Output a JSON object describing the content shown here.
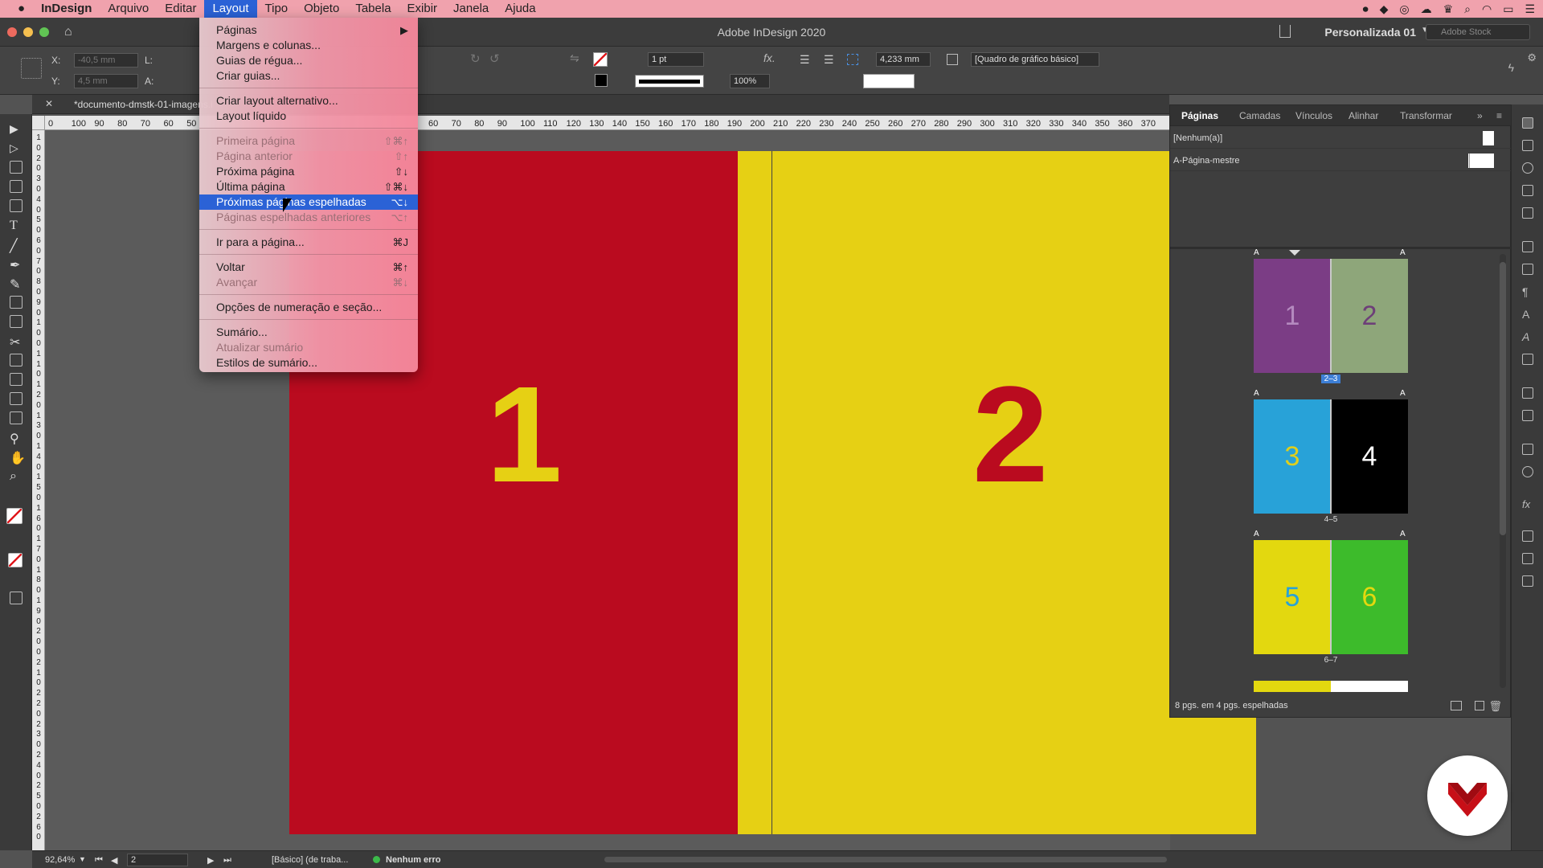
{
  "menubar": {
    "apple": "",
    "app": "InDesign",
    "items": [
      "Arquivo",
      "Editar",
      "Layout",
      "Tipo",
      "Objeto",
      "Tabela",
      "Exibir",
      "Janela",
      "Ajuda"
    ]
  },
  "titlebar": {
    "title": "Adobe InDesign 2020",
    "workspace": "Personalizada 01",
    "search_placeholder": "Adobe Stock"
  },
  "control": {
    "x_label": "X:",
    "x_value": "-40,5 mm",
    "y_label": "Y:",
    "y_value": "4,5 mm",
    "l_label": "L:",
    "a_label": "A:",
    "stroke_weight": "1 pt",
    "scale": "100%",
    "size_value": "4,233 mm",
    "object_style": "[Quadro de gráfico básico]"
  },
  "document": {
    "tab": "*documento-dmstk-01-imagens.i",
    "page1_number": "1",
    "page2_number": "2"
  },
  "ruler": {
    "left_ticks": [
      "0",
      "100",
      "90",
      "80",
      "70",
      "60",
      "50"
    ],
    "right_ticks": [
      "60",
      "70",
      "80",
      "90",
      "100",
      "110",
      "120",
      "130",
      "140",
      "150",
      "160",
      "170",
      "180",
      "190",
      "200",
      "210",
      "220",
      "230",
      "240",
      "250",
      "260",
      "270",
      "280",
      "290",
      "300",
      "310",
      "320",
      "330",
      "340",
      "350",
      "360",
      "370"
    ]
  },
  "menu": {
    "items": [
      {
        "label": "Páginas",
        "shortcut": "▶",
        "disabled": false
      },
      {
        "label": "Margens e colunas...",
        "shortcut": "",
        "disabled": false
      },
      {
        "label": "Guias de régua...",
        "shortcut": "",
        "disabled": false
      },
      {
        "label": "Criar guias...",
        "shortcut": "",
        "disabled": false
      },
      {
        "label": "Criar layout alternativo...",
        "shortcut": "",
        "disabled": false
      },
      {
        "label": "Layout líquido",
        "shortcut": "",
        "disabled": false
      },
      {
        "label": "Primeira página",
        "shortcut": "⇧⌘↑",
        "disabled": true
      },
      {
        "label": "Página anterior",
        "shortcut": "⇧↑",
        "disabled": true
      },
      {
        "label": "Próxima página",
        "shortcut": "⇧↓",
        "disabled": false
      },
      {
        "label": "Última página",
        "shortcut": "⇧⌘↓",
        "disabled": false
      },
      {
        "label": "Próximas páginas espelhadas",
        "shortcut": "⌥↓",
        "disabled": false,
        "highlighted": true
      },
      {
        "label": "Páginas espelhadas anteriores",
        "shortcut": "⌥↑",
        "disabled": true
      },
      {
        "label": "Ir para a página...",
        "shortcut": "⌘J",
        "disabled": false
      },
      {
        "label": "Voltar",
        "shortcut": "⌘↑",
        "disabled": false
      },
      {
        "label": "Avançar",
        "shortcut": "⌘↓",
        "disabled": true
      },
      {
        "label": "Opções de numeração e seção...",
        "shortcut": "",
        "disabled": false
      },
      {
        "label": "Sumário...",
        "shortcut": "",
        "disabled": false
      },
      {
        "label": "Atualizar sumário",
        "shortcut": "",
        "disabled": true
      },
      {
        "label": "Estilos de sumário...",
        "shortcut": "",
        "disabled": false
      }
    ]
  },
  "panel": {
    "tabs": [
      "Páginas",
      "Camadas",
      "Vínculos",
      "Alinhar",
      "Transformar"
    ],
    "masters": [
      "[Nenhum(a)]",
      "A-Página-mestre"
    ],
    "master_prefix": "A",
    "spreads": [
      {
        "label": "2–3",
        "pages": [
          {
            "n": "1",
            "bg": "#7b3d85",
            "fg": "#b48abf"
          },
          {
            "n": "2",
            "bg": "#8ea67a",
            "fg": "#6d3f78"
          }
        ]
      },
      {
        "label": "4–5",
        "pages": [
          {
            "n": "3",
            "bg": "#28a2d8",
            "fg": "#e1cf1a"
          },
          {
            "n": "4",
            "bg": "#000000",
            "fg": "#ffffff"
          }
        ]
      },
      {
        "label": "6–7",
        "pages": [
          {
            "n": "5",
            "bg": "#e3d80f",
            "fg": "#28a2d8"
          },
          {
            "n": "6",
            "bg": "#3dbb2b",
            "fg": "#e3d80f"
          }
        ]
      }
    ],
    "footer": "8 pgs. em 4 pgs. espelhadas"
  },
  "status": {
    "zoom": "92,64%",
    "page": "2",
    "profile": "[Básico] (de traba...",
    "preflight": "Nenhum erro"
  },
  "colors": {
    "page1": "#ba0b1f",
    "page2": "#e6d014",
    "menu_highlight": "#2b62d6",
    "preflight_ok": "#3cba4a"
  }
}
